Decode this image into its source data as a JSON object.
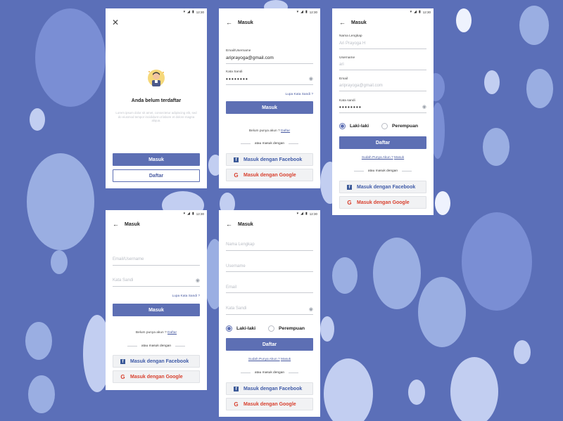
{
  "status": {
    "time": "12:30",
    "icons": [
      "wifi-icon",
      "signal-icon",
      "battery-icon"
    ]
  },
  "s1": {
    "title": "Anda belum terdaftar",
    "desc": "Lorem ipsum dolor sit amet, consectetur adipiscing elit, sed do eiusmod tempor incididunt ut labore et dolore magna aliqua.",
    "login": "Masuk",
    "register": "Daftar"
  },
  "s2": {
    "title": "Masuk",
    "email_label": "Email/Username",
    "email_value": "ariprayoga@gmail.com",
    "password_label": "Kata Sandi",
    "password_value": "••••••••",
    "forgot": "Lupa Kata Sandi ?",
    "login": "Masuk",
    "no_account": "Belum punya akun ?",
    "register_link": "Daftar",
    "or": "atau masuk dengan",
    "facebook": "Masuk dengan Facebook",
    "google": "Masuk dengan Google"
  },
  "s3": {
    "title": "Masuk",
    "name_label": "Nama Lengkap",
    "name_value": "Ari Prayoga H",
    "username_label": "Username",
    "username_value": "ari",
    "email_label": "Email",
    "email_value": "ariprayoga@gmail.com",
    "password_label": "Kata sandi",
    "password_value": "••••••••",
    "male": "Laki-laki",
    "female": "Perempuan",
    "register": "Daftar",
    "have_account": "Sudah Punya Akun ?",
    "login_link": "Masuk",
    "or": "atau masuk dengan",
    "facebook": "Masuk dengan Facebook",
    "google": "Masuk dengan Google"
  },
  "s4": {
    "title": "Masuk",
    "email_ph": "Email/Username",
    "password_ph": "Kata Sandi",
    "forgot": "Lupa Kata Sandi ?",
    "login": "Masuk",
    "no_account": "Belum punya akun ?",
    "register_link": "Daftar",
    "or": "atau masuk dengan",
    "facebook": "Masuk dengan Facebook",
    "google": "Masuk dengan Google"
  },
  "s5": {
    "title": "Masuk",
    "name_ph": "Nama Lengkap",
    "username_ph": "Username",
    "email_ph": "Email",
    "password_ph": "Kata Sandi",
    "male": "Laki-laki",
    "female": "Perempuan",
    "register": "Daftar",
    "have_account": "Sudah Punya Akun ?",
    "login_link": "Masuk",
    "or": "atau masuk dengan",
    "facebook": "Masuk dengan Facebook",
    "google": "Masuk dengan Google"
  },
  "colors": {
    "background": "#5b6fb8",
    "primary": "#5d6fb4",
    "facebook": "#3b5998",
    "google": "#d8412f"
  }
}
